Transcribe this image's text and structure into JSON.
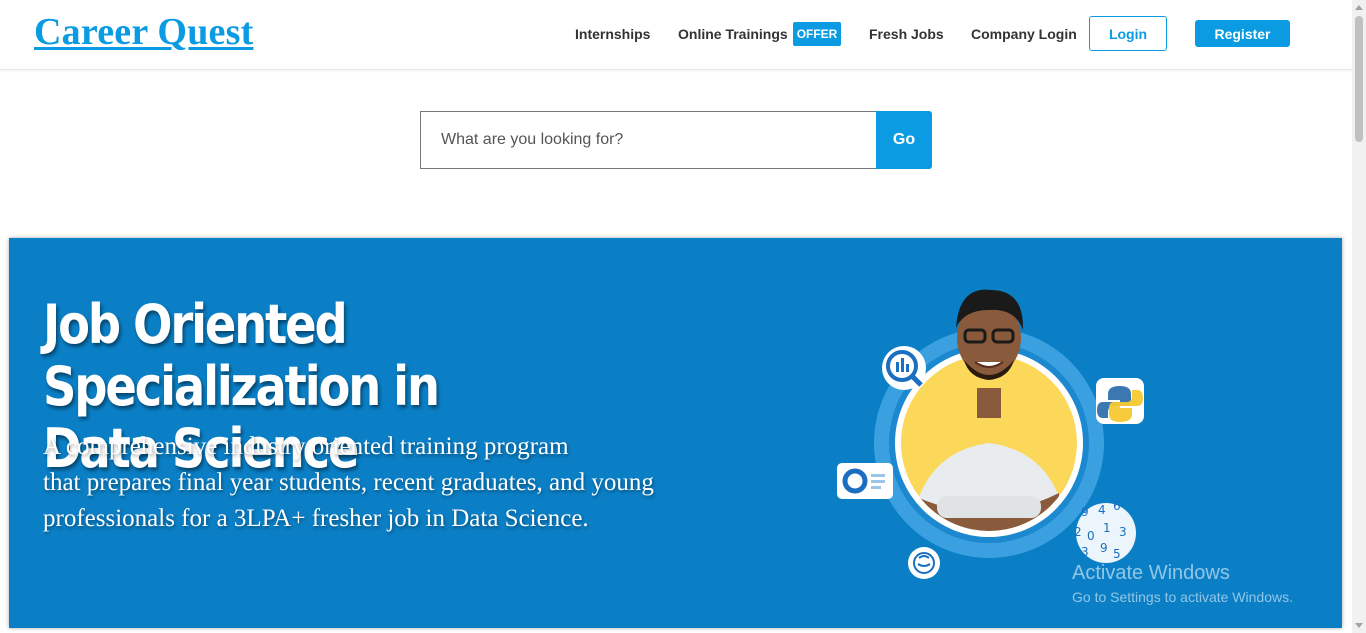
{
  "header": {
    "logo": "Career Quest",
    "nav": {
      "internships": "Internships",
      "online_trainings": "Online Trainings",
      "offer_badge": "OFFER",
      "fresh_jobs": "Fresh Jobs",
      "company_login": "Company Login"
    },
    "login_label": "Login",
    "register_label": "Register"
  },
  "search": {
    "placeholder": "What are you looking for?",
    "value": "",
    "button_label": "Go"
  },
  "banner": {
    "title_line1": "Job Oriented Specialization in",
    "title_line2": "Data Science",
    "subtitle_lines": [
      "A comprehensive industry oriented training program",
      "that prepares final year students, recent graduates, and young",
      "professionals for a 3LPA+ fresher job in Data Science."
    ],
    "numbers_badge": [
      "9",
      "4",
      "6",
      "2",
      "0",
      "1",
      "3",
      "3",
      "9",
      "5"
    ],
    "icons": [
      "analytics-search-icon",
      "python-logo-icon",
      "donut-chart-card-icon",
      "brain-icon",
      "numbers-badge-icon"
    ]
  },
  "watermark": {
    "title": "Activate Windows",
    "subtitle": "Go to Settings to activate Windows."
  },
  "colors": {
    "brand": "#0a9be2",
    "banner_bg": "#0a7fc6",
    "nav_text": "#333333"
  }
}
